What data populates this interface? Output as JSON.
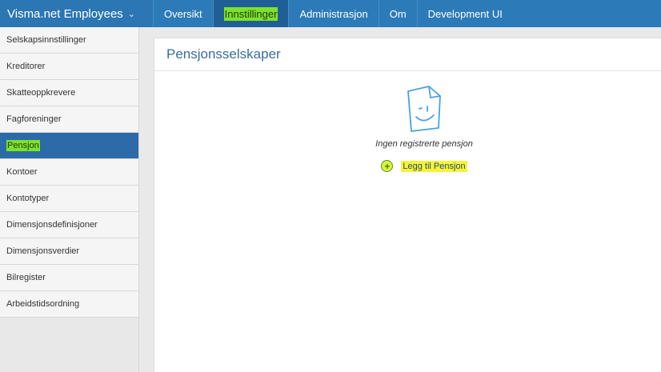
{
  "topbar": {
    "brand": "Visma.net Employees",
    "tabs": [
      {
        "label": "Oversikt"
      },
      {
        "label": "Innstillinger"
      },
      {
        "label": "Administrasjon"
      },
      {
        "label": "Om"
      },
      {
        "label": "Development UI"
      }
    ]
  },
  "sidebar": {
    "items": [
      {
        "label": "Selskapsinnstillinger"
      },
      {
        "label": "Kreditorer"
      },
      {
        "label": "Skatteoppkrevere"
      },
      {
        "label": "Fagforeninger"
      },
      {
        "label": "Pensjon"
      },
      {
        "label": "Kontoer"
      },
      {
        "label": "Kontotyper"
      },
      {
        "label": "Dimensjonsdefinisjoner"
      },
      {
        "label": "Dimensjonsverdier"
      },
      {
        "label": "Bilregister"
      },
      {
        "label": "Arbeidstidsordning"
      }
    ]
  },
  "main": {
    "title": "Pensjonsselskaper",
    "empty_text": "Ingen registrerte pensjon",
    "add_label": "Legg til Pensjon",
    "add_icon": "+"
  }
}
